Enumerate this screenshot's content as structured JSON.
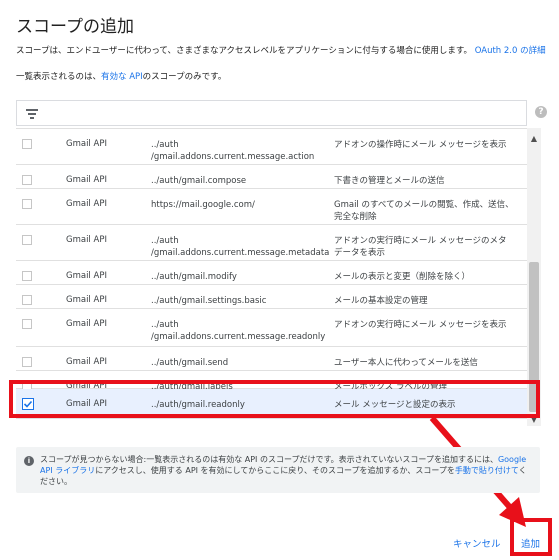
{
  "dialog": {
    "title": "スコープの追加",
    "description_prefix": "スコープは、エンドユーザーに代わって、さまざまなアクセスレベルをアプリケーションに付与する場合に使用します。",
    "description_link": "OAuth 2.0 の詳細",
    "desc2_prefix": "一覧表示されるのは、",
    "desc2_link": "有効な API",
    "desc2_suffix": "のスコープのみです。"
  },
  "filter": {
    "icon": "filter-icon",
    "placeholder": ""
  },
  "help_icon": "?",
  "table": {
    "rows": [
      {
        "api": "Gmail API",
        "scope": "../auth /gmail.addons.current.message.action",
        "description": "アドオンの操作時にメール メッセージを表示",
        "checked": false
      },
      {
        "api": "Gmail API",
        "scope": "../auth/gmail.compose",
        "description": "下書きの管理とメールの送信",
        "checked": false
      },
      {
        "api": "Gmail API",
        "scope": "https://mail.google.com/",
        "description": "Gmail のすべてのメールの閲覧、作成、送信、完全な削除",
        "checked": false
      },
      {
        "api": "Gmail API",
        "scope": "../auth /gmail.addons.current.message.metadata",
        "description": "アドオンの実行時にメール メッセージのメタデータを表示",
        "checked": false
      },
      {
        "api": "Gmail API",
        "scope": "../auth/gmail.modify",
        "description": "メールの表示と変更（削除を除く）",
        "checked": false
      },
      {
        "api": "Gmail API",
        "scope": "../auth/gmail.settings.basic",
        "description": "メールの基本設定の管理",
        "checked": false
      },
      {
        "api": "Gmail API",
        "scope": "../auth /gmail.addons.current.message.readonly",
        "description": "アドオンの実行時にメール メッセージを表示",
        "checked": false
      },
      {
        "api": "Gmail API",
        "scope": "../auth/gmail.send",
        "description": "ユーザー本人に代わってメールを送信",
        "checked": false
      },
      {
        "api": "Gmail API",
        "scope": "../auth/gmail.labels",
        "description": "メールボックス ラベルの管理",
        "checked": false
      },
      {
        "api": "Gmail API",
        "scope": "../auth/gmail.readonly",
        "description": "メール メッセージと設定の表示",
        "checked": true
      }
    ]
  },
  "info": {
    "text_prefix": "スコープが見つからない場合:一覧表示されるのは有効な API のスコープだけです。表示されていないスコープを追加するには、",
    "link1": "Google API ライブラリ",
    "text_middle": "にアクセスし、使用する API を有効にしてからここに戻り、そのスコープを追加するか、スコープを",
    "link2": "手動で貼り付けて",
    "text_suffix": "ください。"
  },
  "footer": {
    "cancel_label": "キャンセル",
    "add_label": "追加"
  },
  "colors": {
    "accent": "#1a73e8",
    "highlight": "#e8101a",
    "selected_row": "#e8f0fe"
  }
}
